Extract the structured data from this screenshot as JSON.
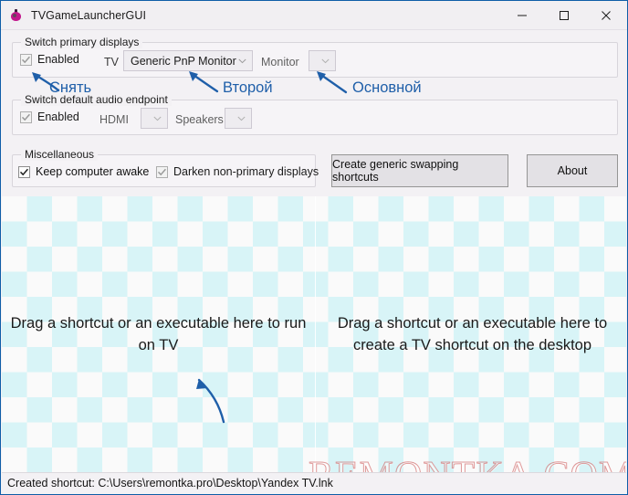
{
  "window": {
    "title": "TVGameLauncherGUI",
    "icon": "app-icon",
    "controls": {
      "minimize": "minimize-icon",
      "maximize": "maximize-icon",
      "close": "close-icon"
    }
  },
  "groups": {
    "displays": {
      "legend": "Switch primary displays",
      "enabled_label": "Enabled",
      "enabled_checked": true,
      "tv_label": "TV",
      "tv_value": "Generic PnP Monitor",
      "monitor_label": "Monitor",
      "monitor_value": ""
    },
    "audio": {
      "legend": "Switch default audio endpoint",
      "enabled_label": "Enabled",
      "enabled_checked": true,
      "hdmi_label": "HDMI",
      "hdmi_value": "",
      "speakers_label": "Speakers",
      "speakers_value": ""
    },
    "misc": {
      "legend": "Miscellaneous",
      "keep_awake_label": "Keep computer awake",
      "keep_awake_checked": true,
      "darken_label": "Darken non-primary displays",
      "darken_checked": true
    }
  },
  "buttons": {
    "create_shortcuts": "Create generic swapping shortcuts",
    "about": "About"
  },
  "drop_zones": {
    "left": "Drag a shortcut or an executable here to run on TV",
    "right": "Drag a shortcut or an executable here to create a TV shortcut on the desktop"
  },
  "status": {
    "text": "Created shortcut: C:\\Users\\remontka.pro\\Desktop\\Yandex TV.lnk"
  },
  "annotations": {
    "snyat": "Снять",
    "vtoroy": "Второй",
    "osnovnoy": "Основной",
    "color": "#1f5fa9"
  },
  "watermark": {
    "text": "REMONTKA.COM",
    "color": "#d67878"
  }
}
